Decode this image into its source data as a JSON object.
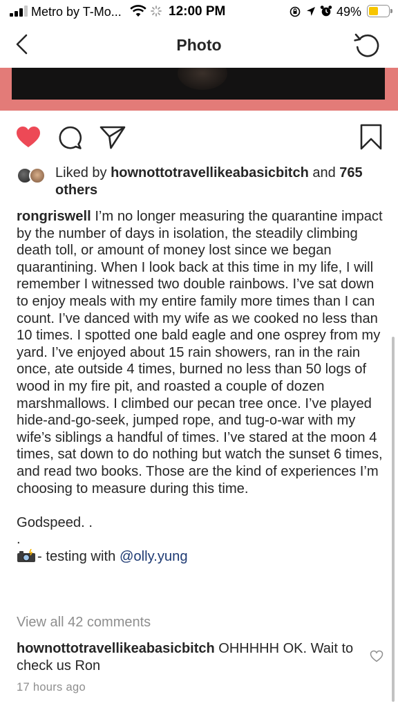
{
  "status_bar": {
    "carrier": "Metro by T-Mo...",
    "time": "12:00 PM",
    "battery_percent": "49%",
    "battery_level": 0.49,
    "battery_color": "#f7c500"
  },
  "nav": {
    "back_icon": "chevron-left-icon",
    "title": "Photo",
    "refresh_icon": "refresh-icon"
  },
  "actions": {
    "like_icon": "heart-filled-icon",
    "like_color": "#ed4956",
    "comment_icon": "comment-icon",
    "share_icon": "share-icon",
    "save_icon": "bookmark-icon"
  },
  "likes": {
    "prefix": "Liked by",
    "user": "hownottotravellikeabasicbitch",
    "and": "and",
    "others": "765 others"
  },
  "caption": {
    "username": "rongriswell",
    "body": "I’m no longer measuring the quarantine impact by the number of days in isolation, the steadily climbing death toll, or amount of money lost since we began quarantining. When I look back at this time in my life, I will remember I witnessed two double rainbows. I’ve sat down to enjoy meals with my entire family more times than I can count. I’ve danced with my wife as we cooked no less than 10 times. I spotted one bald eagle and one osprey from my yard. I’ve enjoyed about 15 rain showers, ran in the rain once, ate outside 4 times, burned no less than 50 logs of wood in my fire pit, and roasted a couple of dozen marshmallows. I climbed our pecan tree once. I’ve played hide-and-go-seek, jumped rope, and tug-o-war with my wife’s siblings a handful of times. I’ve stared at the moon 4 times, sat down to do nothing but watch the sunset 6 times, and read two books. Those are the kind of experiences I’m choosing to measure during this time.",
    "signoff": "Godspeed. .",
    "dot": ".",
    "credit_icon": "camera-flash-icon",
    "credit_text": "- testing with",
    "mention": "@olly.yung"
  },
  "comments": {
    "view_all": "View all 42 comments",
    "items": [
      {
        "user": "hownottotravellikeabasicbitch",
        "text": "OHHHHH OK. Wait to check us Ron"
      }
    ]
  },
  "timestamp": "17 hours ago"
}
